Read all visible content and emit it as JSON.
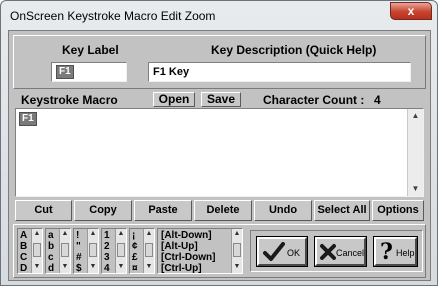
{
  "window": {
    "title": "OnScreen Keystroke Macro Edit Zoom",
    "close_glyph": "x"
  },
  "key_section": {
    "key_label_header": "Key Label",
    "key_desc_header": "Key Description (Quick Help)",
    "key_label_value": "F1",
    "key_desc_value": "F1 Key"
  },
  "macro_section": {
    "header": "Keystroke Macro",
    "open_label": "Open",
    "save_label": "Save",
    "char_count_label": "Character Count :",
    "char_count_value": "4",
    "content_token": "F1"
  },
  "edit_buttons": [
    "Cut",
    "Copy",
    "Paste",
    "Delete",
    "Undo",
    "Select All",
    "Options"
  ],
  "char_lists": [
    {
      "items": "A\nB\nC\nD"
    },
    {
      "items": "a\nb\nc\nd"
    },
    {
      "items": "!\n\"\n#\n$"
    },
    {
      "items": "1\n2\n3\n4"
    },
    {
      "items": "¡\n¢\n£\n¤"
    },
    {
      "items": "[Alt-Down]\n[Alt-Up]\n[Ctrl-Down]\n[Ctrl-Up]"
    }
  ],
  "action_buttons": {
    "ok": "OK",
    "cancel": "Cancel",
    "help": "Help"
  },
  "icons": {
    "ok": "checkmark-icon",
    "cancel": "x-mark-icon",
    "help": "question-mark-icon"
  }
}
